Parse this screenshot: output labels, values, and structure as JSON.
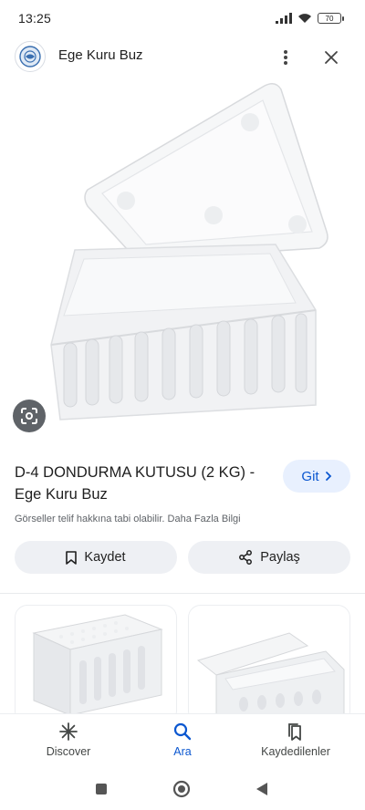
{
  "status_bar": {
    "time": "13:25",
    "battery": "70"
  },
  "header": {
    "site_name": "Ege Kuru Buz"
  },
  "result": {
    "title": "D-4 DONDURMA KUTUSU (2 KG) - Ege Kuru Buz",
    "go_label": "Git",
    "copyright": "Görseller telif hakkına tabi olabilir. Daha Fazla Bilgi"
  },
  "actions": {
    "save_label": "Kaydet",
    "share_label": "Paylaş"
  },
  "bottom_nav": {
    "items": [
      {
        "label": "Discover",
        "icon": "asterisk-icon"
      },
      {
        "label": "Ara",
        "icon": "search-icon",
        "active": true
      },
      {
        "label": "Kaydedilenler",
        "icon": "bookmarks-icon"
      }
    ]
  },
  "colors": {
    "accent": "#0b57d0",
    "pill_bg": "#eef0f4",
    "go_bg": "#e8f0fe"
  }
}
